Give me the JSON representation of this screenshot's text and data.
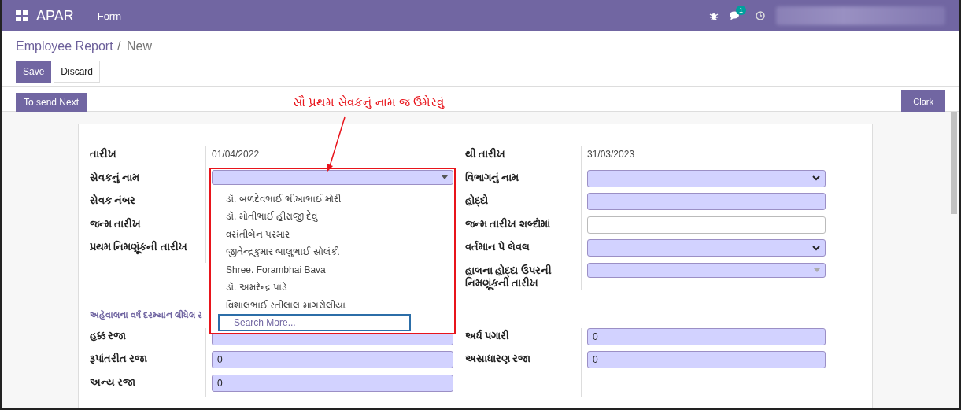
{
  "navbar": {
    "app": "APAR",
    "menu": "Form",
    "chat_badge": "1"
  },
  "breadcrumb": {
    "parent": "Employee Report",
    "separator": "/",
    "current": "New"
  },
  "buttons": [
    {
      "label": "Save",
      "kind": "primary"
    },
    {
      "label": "Discard",
      "kind": "secondary"
    }
  ],
  "statusbar": {
    "left_button": "To send Next",
    "right_button": "Clark"
  },
  "annotation": "સૌ પ્રથમ સેવકનું નામ જ ઉમેરવું",
  "left_fields": [
    {
      "label": "તારીખ",
      "kind": "text",
      "value": "01/04/2022"
    },
    {
      "label": "સેવકનું નામ",
      "kind": "combo",
      "required": true,
      "open": true
    },
    {
      "label": "સેવક નંબર",
      "kind": "covered"
    },
    {
      "label": "જન્મ તારીખ",
      "kind": "covered"
    },
    {
      "label": "પ્રથમ નિમણૂંકની તારીખ",
      "kind": "covered"
    }
  ],
  "dropdown": {
    "options": [
      "ડૉ. બળદેવભાઈ ભીખાભાઈ મોરી",
      "ડૉ. મોતીભાઈ હીરાજી દેવુ",
      "વસંતીબેન પરમાર",
      "જીતેન્દ્રકુમાર બાલુભાઈ સોલંકી",
      "Shree. Forambhai Bava",
      "ડૉ. અમરેન્દ્ર પાંડે",
      "વિશાલભાઈ રતીલાલ માંગરોલીયા"
    ],
    "search_more": "Search More..."
  },
  "right_fields": [
    {
      "label": "થી તારીખ",
      "kind": "text",
      "value": "31/03/2023"
    },
    {
      "label": "વિભાગનું નામ",
      "kind": "select",
      "required": true
    },
    {
      "label": "હોદ્દો",
      "kind": "input",
      "required": true
    },
    {
      "label": "જન્મ તારીખ શબ્દોમાં",
      "kind": "input",
      "required": false
    },
    {
      "label": "વર્તમાન પે લેવલ",
      "kind": "select",
      "required": true
    },
    {
      "label": "હાલના હોદ્દા ઉપરની નિમણૂંકની તારીખ",
      "kind": "combo",
      "required": true
    }
  ],
  "section_title": "અહેવાલના વર્ષ દરમ્યાન લીધેલ ર",
  "leave_left": [
    {
      "label": "હક્ક રજા",
      "required": true
    },
    {
      "label": "રૂપાંતરીત રજા",
      "value": "0",
      "required": true
    },
    {
      "label": "અન્ય રજા",
      "value": "0",
      "required": true
    }
  ],
  "leave_right": [
    {
      "label": "અર્ધ પગારી",
      "value": "0",
      "required": true
    },
    {
      "label": "અસાધારણ રજા",
      "value": "0",
      "required": true
    }
  ]
}
